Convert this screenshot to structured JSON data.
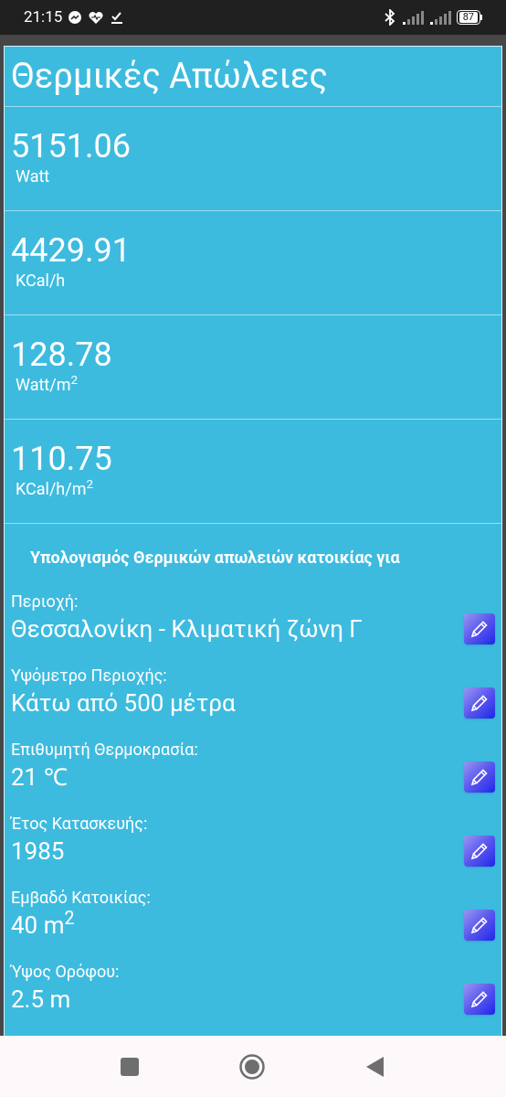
{
  "status_bar": {
    "time": "21:15",
    "battery": "87"
  },
  "title": "Θερμικές Απώλειες",
  "results": [
    {
      "value": "5151.06",
      "unit": "Watt"
    },
    {
      "value": "4429.91",
      "unit": "KCal/h"
    },
    {
      "value": "128.78",
      "unit": "Watt/m$^{2}$"
    },
    {
      "value": "110.75",
      "unit": "KCal/h/m$^{2}$"
    }
  ],
  "section_heading": "Υπολογισμός Θερμικών απωλειών κατοικίας για",
  "fields": [
    {
      "label": "Περιοχή:",
      "value": "Θεσσαλονίκη - Κλιματική ζώνη Γ"
    },
    {
      "label": "Υψόμετρο Περιοχής:",
      "value": "Κάτω από 500 μέτρα"
    },
    {
      "label": "Επιθυμητή Θερμοκρασία:",
      "value": "21 ℃"
    },
    {
      "label": "Έτος Κατασκευής:",
      "value": "1985"
    },
    {
      "label": "Εμβαδό Κατοικίας:",
      "value": "40 m$^{2}$"
    },
    {
      "label": "Ύψος Ορόφου:",
      "value": "2.5 m"
    }
  ]
}
